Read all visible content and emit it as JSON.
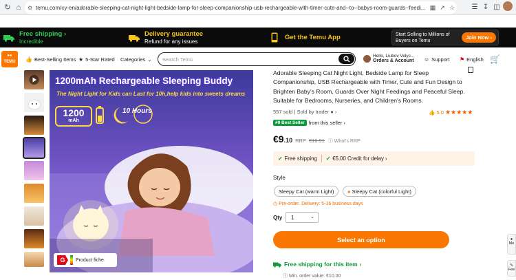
{
  "browser": {
    "url": "temu.com/cy-en/adorable-sleeping-cat-night-light-bedside-lamp-for-sleep-companionship-usb-rechargeable-with-timer-cute-and--to--babys-room-guards--feedi..."
  },
  "promo": {
    "free_shipping_title": "Free shipping",
    "free_shipping_sub": "Incredible",
    "delivery_title": "Delivery guarantee",
    "delivery_sub": "Refund for any issues",
    "app_title": "Get the Temu App",
    "seller_text": "Start Selling to Millions of Buyers on Temu",
    "join_label": "Join Now"
  },
  "header": {
    "logo_text": "TEMU",
    "best_selling": "Best-Selling Items",
    "five_star": "5-Star Rated",
    "categories": "Categories",
    "search_placeholder": "Search Temu",
    "user_hello": "Hello, Liubov Velyc...",
    "user_orders": "Orders & Account",
    "support": "Support",
    "language": "English"
  },
  "gallery": {
    "title": "1200mAh Rechargeable Sleeping Buddy",
    "subtitle": "The Night Light for Kids can Last for 10h,help kids into sweets dreams",
    "battery_value": "1200",
    "battery_unit": "mAh",
    "hours_label": "10 Hours",
    "energy_class": "G",
    "product_fiche": "Product fiche"
  },
  "product": {
    "title": "Adorable Sleeping Cat Night Light, Bedside Lamp for Sleep Companionship, USB Rechargeable with Timer, Cute and Fun Design to Brighten Baby's Room, Guards Over Night Feedings and Peaceful Sleep. Suitable for Bedrooms, Nurseries, and Children's Rooms.",
    "sold": "557 sold",
    "sold_by": "Sold by trader",
    "rating": "5.0",
    "best_seller_badge": "#9 Best Seller",
    "best_seller_text": "from this seller",
    "price_main": "€9",
    "price_cents": ".10",
    "rrp_label": "RRP",
    "rrp_value": "€16.91",
    "whats_rrp": "What's RRP",
    "free_shipping": "Free shipping",
    "credit_delay": "€5.00 Credit for delay",
    "style_label": "Style",
    "style_options": [
      "Sleepy Cat (warm Light)",
      "Sleepy Cat (colorful Light)"
    ],
    "preorder": "Pre-order. Delivery: 5-16 business days",
    "qty_label": "Qty",
    "qty_value": "1",
    "cta_label": "Select an option",
    "free_ship_item": "Free shipping for this item",
    "min_order": "Min. order value: €10.00"
  },
  "side": {
    "tool1": "Me",
    "tool2": "Fee"
  },
  "colors": {
    "brand_orange": "#fb7701",
    "green": "#0e9a3b",
    "promo_bg": "#0b0b0b"
  }
}
